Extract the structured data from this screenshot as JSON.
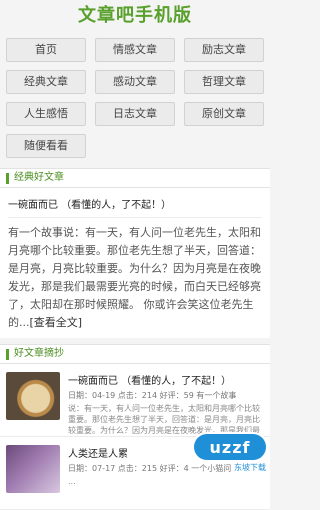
{
  "header": {
    "title": "文章吧手机版"
  },
  "nav": {
    "items": [
      "首页",
      "情感文章",
      "励志文章",
      "经典文章",
      "感动文章",
      "哲理文章",
      "人生感悟",
      "日志文章",
      "原创文章",
      "随便看看"
    ]
  },
  "classic": {
    "heading": "经典好文章",
    "article_title": "一碗面而已 （看懂的人，了不起！）",
    "article_body": "有一个故事说：有一天，有人问一位老先生，太阳和月亮哪个比较重要。那位老先生想了半天，回答道：是月亮，月亮比较重要。为什么？因为月亮是在夜晚发光，那是我们最需要光亮的时候，而白天已经够亮了，太阳却在那时候照耀。 你或许会笑这位老先生的...",
    "more_label": "[查看全文]"
  },
  "recommend": {
    "heading": "好文章摘抄",
    "items": [
      {
        "title": "一碗面而已 （看懂的人，了不起！）",
        "meta": "日期：04-19 点击：214 好评：59 有一个故事",
        "excerpt": "说：有一天，有人问一位老先生，太阳和月亮哪个比较重要。那位老先生想了半天，回答道：是月亮，月亮比较重要。为什么？因为月亮是在夜晚发光，那是我们最需要光亮的"
      },
      {
        "title": "人类还是人累",
        "meta": "日期：07-17 点击：215 好评：4 一个小猫问",
        "excerpt": "..."
      }
    ]
  },
  "watermark": {
    "logo": "uzzf",
    "sub": "东坡下载"
  },
  "colors": {
    "accent": "#5aa02c",
    "logo": "#1f8fd8"
  }
}
